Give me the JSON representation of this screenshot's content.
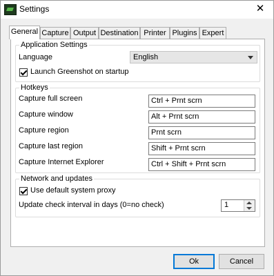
{
  "window": {
    "title": "Settings",
    "close_glyph": "✕",
    "app_icon": "greenshot-icon"
  },
  "tabs": [
    {
      "label": "General"
    },
    {
      "label": "Capture"
    },
    {
      "label": "Output"
    },
    {
      "label": "Destination"
    },
    {
      "label": "Printer"
    },
    {
      "label": "Plugins"
    },
    {
      "label": "Expert"
    }
  ],
  "application_settings": {
    "title": "Application Settings",
    "language_label": "Language",
    "language_value": "English",
    "launch_label": "Launch Greenshot on startup",
    "launch_checked": true
  },
  "hotkeys": {
    "title": "Hotkeys",
    "rows": [
      {
        "label": "Capture full screen",
        "value": "Ctrl + Prnt scrn"
      },
      {
        "label": "Capture window",
        "value": "Alt + Prnt scrn"
      },
      {
        "label": "Capture region",
        "value": "Prnt scrn"
      },
      {
        "label": "Capture last region",
        "value": "Shift + Prnt scrn"
      },
      {
        "label": "Capture Internet Explorer",
        "value": "Ctrl + Shift + Prnt scrn"
      }
    ]
  },
  "network": {
    "title": "Network and updates",
    "proxy_label": "Use default system proxy",
    "proxy_checked": true,
    "interval_label": "Update check interval in days (0=no check)",
    "interval_value": "1"
  },
  "buttons": {
    "ok": "Ok",
    "cancel": "Cancel"
  }
}
